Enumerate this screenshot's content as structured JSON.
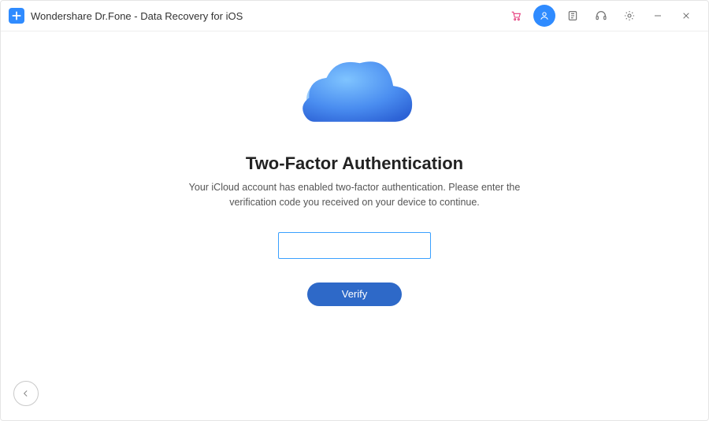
{
  "title": "Wondershare Dr.Fone - Data Recovery for iOS",
  "icons": {
    "app": "app-logo",
    "cart": "cart-icon",
    "user": "user-icon",
    "feedback": "feedback-icon",
    "support": "headset-icon",
    "settings": "gear-icon",
    "minimize": "minimize-icon",
    "close": "close-icon",
    "back": "back-arrow-icon",
    "cloud": "cloud-icon"
  },
  "main": {
    "heading": "Two-Factor Authentication",
    "description": "Your iCloud account has enabled two-factor authentication. Please enter the verification code you received on your device to continue.",
    "code_value": "",
    "code_placeholder": "",
    "verify_label": "Verify"
  }
}
